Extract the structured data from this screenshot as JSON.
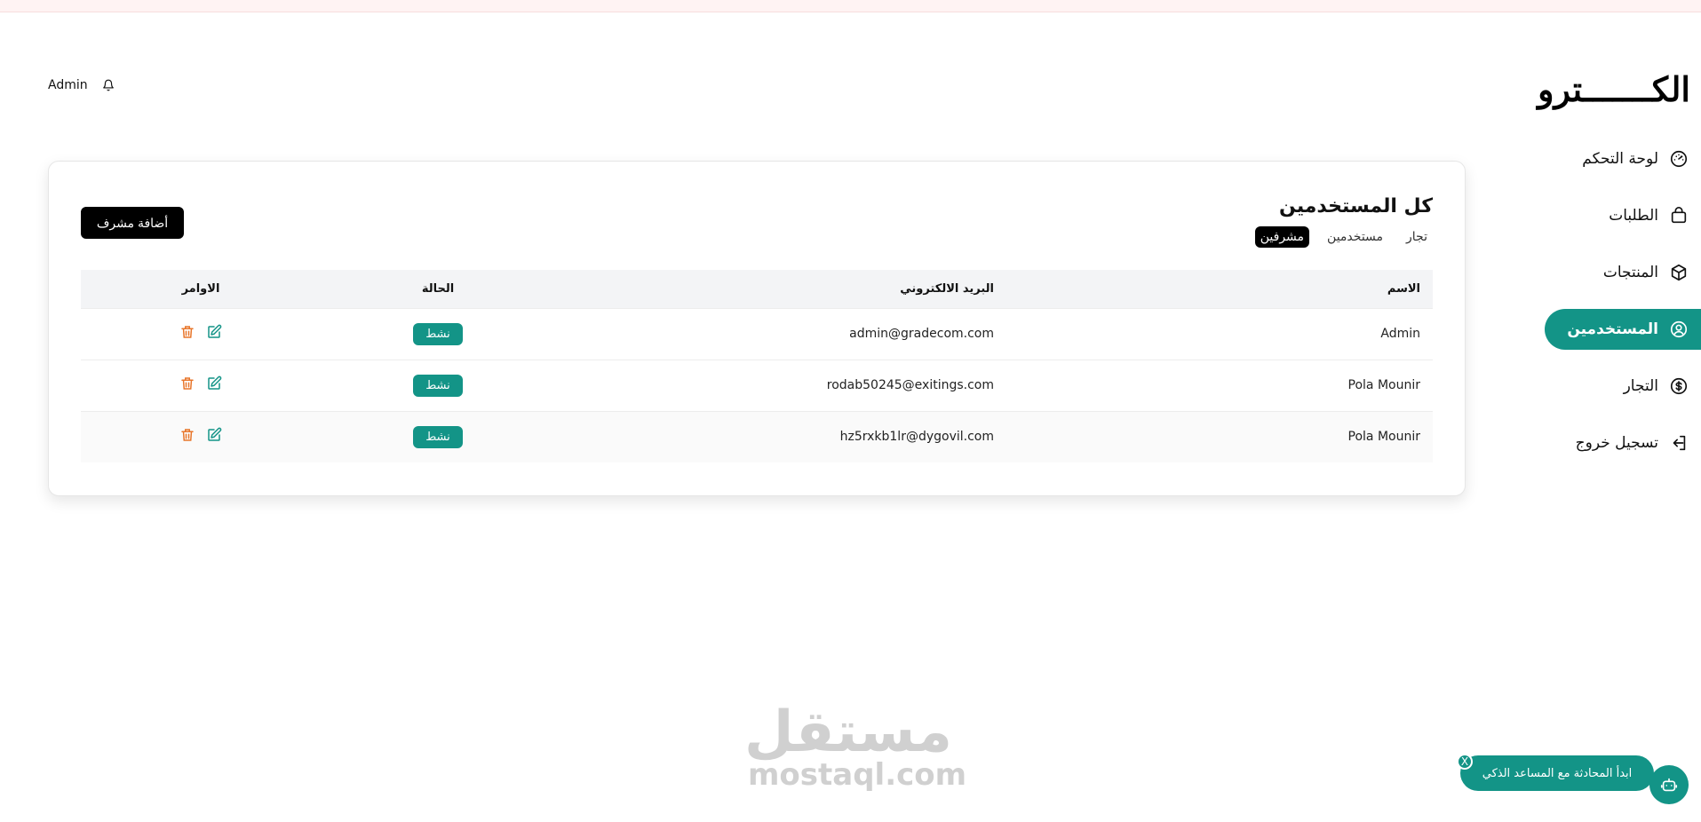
{
  "header": {
    "admin_name": "Admin",
    "logo_text": "الكـــــــترو"
  },
  "sidebar": {
    "items": [
      {
        "label": "لوحة التحكم",
        "icon": "gauge-icon"
      },
      {
        "label": "الطلبات",
        "icon": "shopping-bag-icon"
      },
      {
        "label": "المنتجات",
        "icon": "box-icon"
      },
      {
        "label": "المستخدمين",
        "icon": "user-circle-icon",
        "active": true
      },
      {
        "label": "التجار",
        "icon": "dollar-circle-icon"
      },
      {
        "label": "تسجيل خروج",
        "icon": "logout-icon"
      }
    ]
  },
  "card": {
    "title": "كل المستخدمين",
    "add_button": "أضافة مشرف",
    "tabs": [
      {
        "label": "مشرفين",
        "active": true
      },
      {
        "label": "مستخدمين"
      },
      {
        "label": "تجار"
      }
    ],
    "columns": {
      "name": "الاسم",
      "email": "البريد الالكتروني",
      "status": "الحالة",
      "actions": "الاوامر"
    },
    "rows": [
      {
        "name": "Admin",
        "email": "admin@gradecom.com",
        "status": "نشط"
      },
      {
        "name": "Pola Mounir",
        "email": "rodab50245@exitings.com",
        "status": "نشط"
      },
      {
        "name": "Pola Mounir",
        "email": "hz5rxkb1lr@dygovil.com",
        "status": "نشط"
      }
    ]
  },
  "watermark": {
    "arabic": "مستقل",
    "latin": "mostaql.com"
  },
  "chat": {
    "prompt": "ابدأ المحادثة مع المساعد الذكي",
    "close": "X"
  },
  "colors": {
    "accent": "#139487",
    "delete": "#e8762b"
  }
}
